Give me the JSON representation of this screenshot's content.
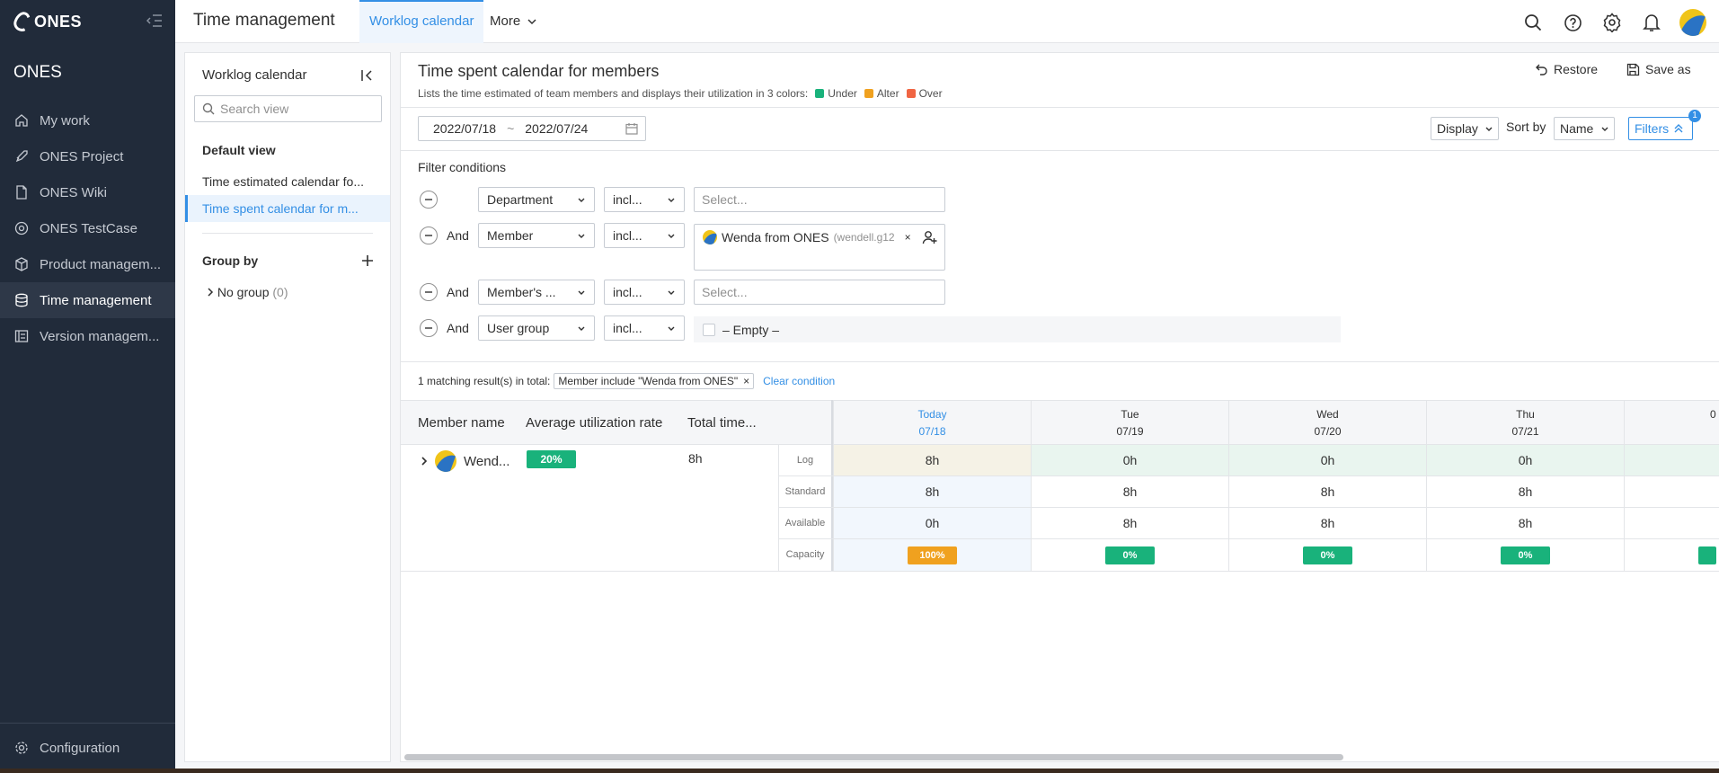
{
  "brand": {
    "logo_text": "ONES",
    "org_name": "ONES"
  },
  "sidebar": {
    "items": [
      {
        "label": "My work",
        "icon": "home-icon"
      },
      {
        "label": "ONES Project",
        "icon": "rocket-icon"
      },
      {
        "label": "ONES Wiki",
        "icon": "doc-icon"
      },
      {
        "label": "ONES TestCase",
        "icon": "target-icon"
      },
      {
        "label": "Product managem...",
        "icon": "box-icon"
      },
      {
        "label": "Time management",
        "icon": "database-icon",
        "active": true
      },
      {
        "label": "Version managem...",
        "icon": "version-icon"
      }
    ],
    "configuration": "Configuration"
  },
  "header": {
    "app_title": "Time management",
    "tabs": [
      {
        "label": "Worklog calendar",
        "active": true
      },
      {
        "label": "More"
      }
    ]
  },
  "left_panel": {
    "title": "Worklog calendar",
    "search_placeholder": "Search view",
    "default_view_heading": "Default view",
    "views": [
      {
        "label": "Time estimated calendar fo...",
        "active": false
      },
      {
        "label": "Time spent calendar for m...",
        "active": true
      }
    ],
    "group_by_heading": "Group by",
    "no_group_label": "No group",
    "no_group_count": "(0)"
  },
  "main": {
    "title": "Time spent calendar for members",
    "description": "Lists the time estimated of team members and displays their utilization in 3 colors:",
    "legend": [
      {
        "label": "Under",
        "color": "#19b27b"
      },
      {
        "label": "Alter",
        "color": "#f0a11f"
      },
      {
        "label": "Over",
        "color": "#f06543"
      }
    ],
    "restore_label": "Restore",
    "save_as_label": "Save as",
    "date_from": "2022/07/18",
    "date_sep": "~",
    "date_to": "2022/07/24",
    "display_label": "Display",
    "sort_by_label": "Sort by",
    "sort_value": "Name",
    "filters_label": "Filters",
    "filters_count": "1"
  },
  "filters": {
    "title": "Filter conditions",
    "rows": [
      {
        "connector": "",
        "field": "Department",
        "op": "incl...",
        "placeholder": "Select..."
      },
      {
        "connector": "And",
        "field": "Member",
        "op": "incl...",
        "tag_name": "Wenda from ONES",
        "tag_sub": "(wendell.g12",
        "tag_close": "×"
      },
      {
        "connector": "And",
        "field": "Member's ...",
        "op": "incl...",
        "placeholder": "Select..."
      },
      {
        "connector": "And",
        "field": "User group",
        "op": "incl...",
        "empty_label": "– Empty –"
      }
    ]
  },
  "results": {
    "summary": "1 matching result(s) in total:",
    "condition_tag": "Member include \"Wenda from ONES\"",
    "condition_close": "×",
    "clear_label": "Clear condition"
  },
  "table": {
    "headers": {
      "member_name": "Member name",
      "avg_util": "Average utilization rate",
      "total_time": "Total time..."
    },
    "days": [
      {
        "weekday": "Today",
        "date": "07/18",
        "today": true
      },
      {
        "weekday": "Tue",
        "date": "07/19"
      },
      {
        "weekday": "Wed",
        "date": "07/20"
      },
      {
        "weekday": "Thu",
        "date": "07/21"
      },
      {
        "weekday": "",
        "date": "0"
      }
    ],
    "row_labels": [
      "Log",
      "Standard",
      "Available",
      "Capacity"
    ],
    "member": {
      "name": "Wend...",
      "avg_util": "20%",
      "total_time": "8h",
      "log": [
        "8h",
        "0h",
        "0h",
        "0h"
      ],
      "standard": [
        "8h",
        "8h",
        "8h",
        "8h"
      ],
      "available": [
        "0h",
        "8h",
        "8h",
        "8h"
      ],
      "capacity": [
        {
          "value": "100%",
          "color": "#f0a11f"
        },
        {
          "value": "0%",
          "color": "#19b27b"
        },
        {
          "value": "0%",
          "color": "#19b27b"
        },
        {
          "value": "0%",
          "color": "#19b27b"
        }
      ]
    }
  }
}
